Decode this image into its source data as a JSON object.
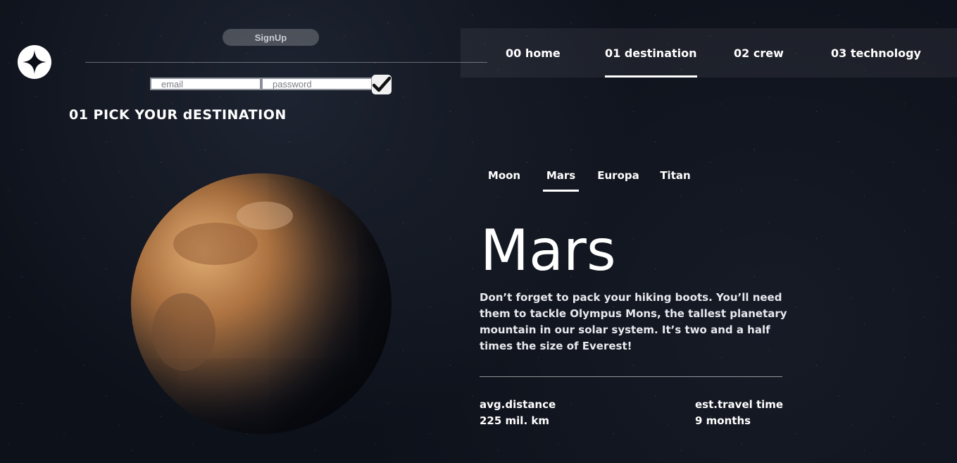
{
  "auth": {
    "signup_label": "SignUp",
    "email_placeholder": "email",
    "password_placeholder": "password"
  },
  "nav": {
    "items": [
      {
        "label": "00 home"
      },
      {
        "label": "01 destination",
        "active": true
      },
      {
        "label": "02 crew"
      },
      {
        "label": "03 technology"
      }
    ]
  },
  "page": {
    "title": "01 PICK YOUR dESTINATION"
  },
  "destinations": {
    "tabs": [
      {
        "label": "Moon"
      },
      {
        "label": "Mars",
        "active": true
      },
      {
        "label": "Europa"
      },
      {
        "label": "Titan"
      }
    ]
  },
  "planet": {
    "name": "Mars",
    "description": "Don’t forget to pack your hiking boots. You’ll need them to tackle Olympus Mons, the tallest planetary mountain in our solar system. It’s two and a half times the size of Everest!",
    "distance_label": "avg.distance",
    "distance_value": "225 mil. km",
    "travel_label": "est.travel time",
    "travel_value": "9 months"
  },
  "icons": {
    "logo": "star-logo-icon",
    "submit": "checkmark-icon"
  },
  "colors": {
    "background": "#0d111a",
    "text": "#ffffff",
    "nav_bg": "rgba(255,255,255,0.06)"
  }
}
